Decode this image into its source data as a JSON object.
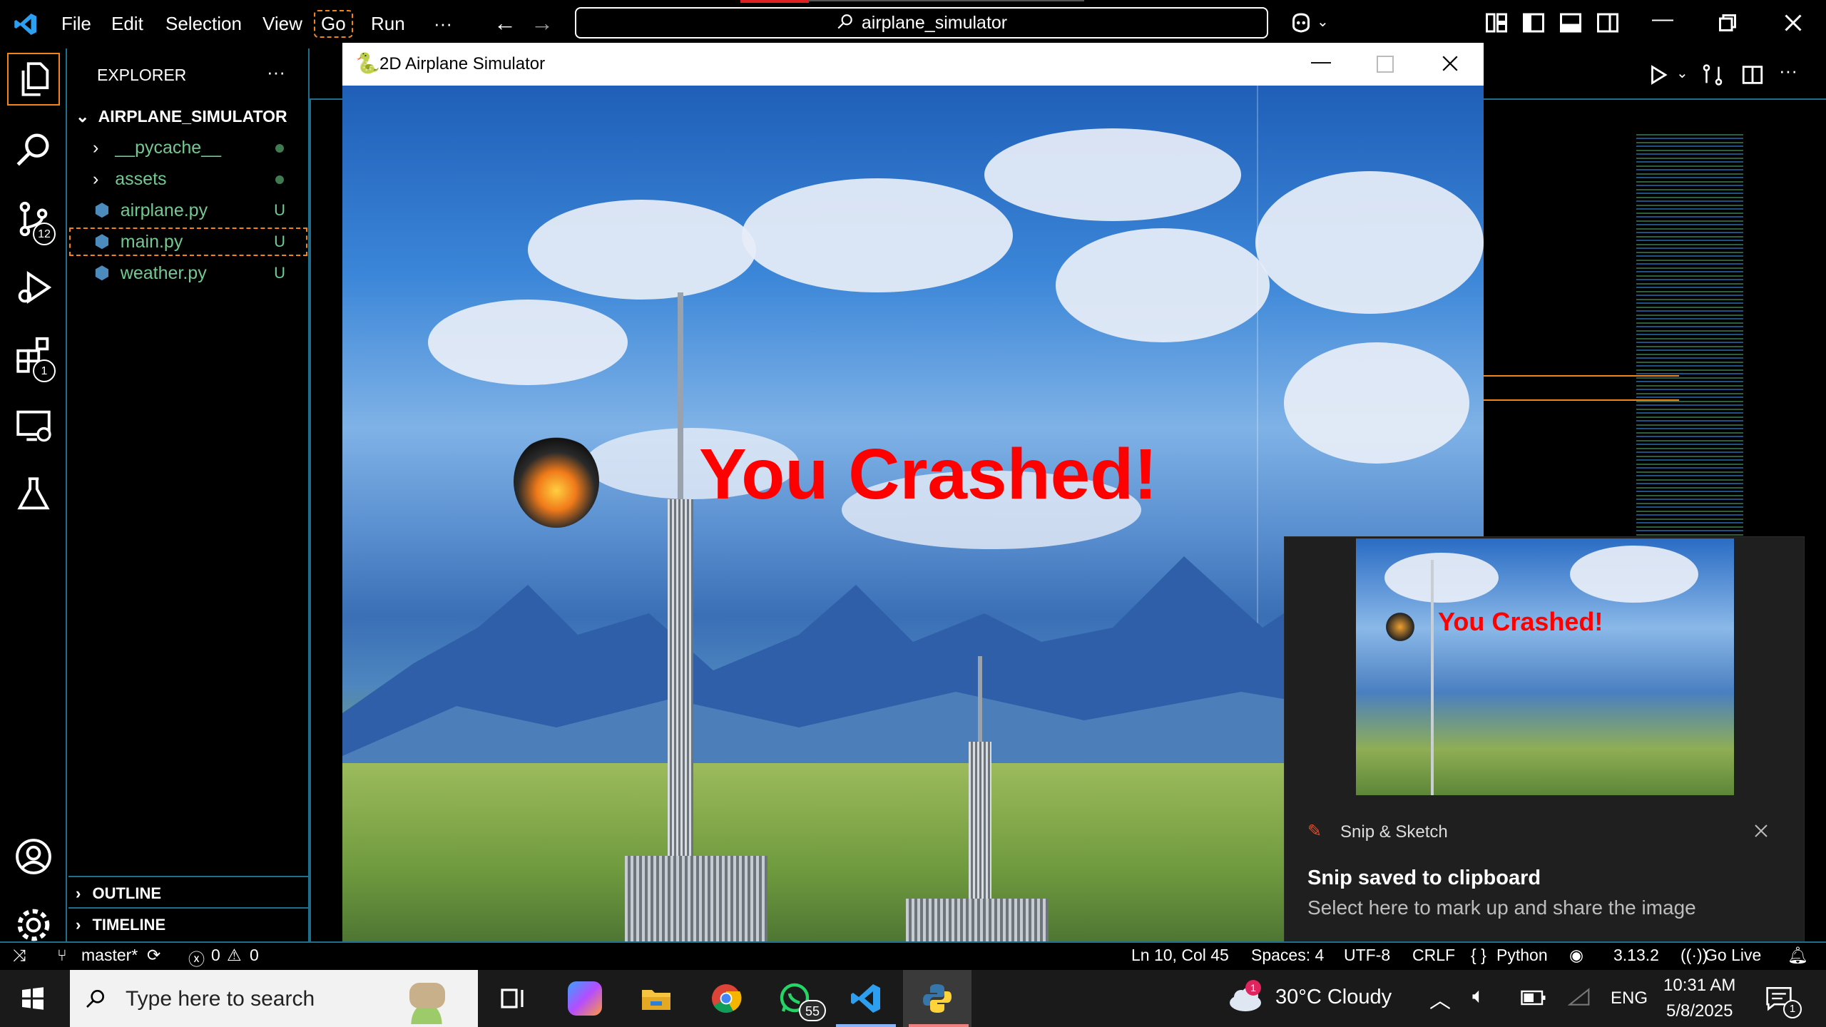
{
  "titlebar": {
    "menu": [
      "File",
      "Edit",
      "Selection",
      "View",
      "Go",
      "Run",
      "···"
    ],
    "search_text": "airplane_simulator"
  },
  "activitybar": {
    "scm_badge": "12",
    "extensions_badge": "1"
  },
  "explorer": {
    "header": "EXPLORER",
    "more": "···",
    "root": "AIRPLANE_SIMULATOR",
    "items": [
      {
        "label": "__pycache__",
        "type": "folder",
        "status": "dot"
      },
      {
        "label": "assets",
        "type": "folder",
        "status": "dot"
      },
      {
        "label": "airplane.py",
        "type": "file",
        "status": "U"
      },
      {
        "label": "main.py",
        "type": "file",
        "status": "U"
      },
      {
        "label": "weather.py",
        "type": "file",
        "status": "U"
      }
    ],
    "outline": "OUTLINE",
    "timeline": "TIMELINE"
  },
  "game_window": {
    "title": "2D Airplane Simulator",
    "message": "You Crashed!",
    "message_color": "#ff0000"
  },
  "toast": {
    "app": "Snip & Sketch",
    "title": "Snip saved to clipboard",
    "body": "Select here to mark up and share the image",
    "thumb_message": "You Crashed!"
  },
  "statusbar": {
    "branch": "master*",
    "errors": "0",
    "warnings": "0",
    "position": "Ln 10, Col 45",
    "spaces": "Spaces: 4",
    "encoding": "UTF-8",
    "eol": "CRLF",
    "language": "Python",
    "version": "3.13.2",
    "golive": "Go Live"
  },
  "taskbar": {
    "search_placeholder": "Type here to search",
    "whatsapp_badge": "55",
    "weather": "30°C  Cloudy",
    "weather_badge": "1",
    "language": "ENG",
    "time": "10:31 AM",
    "date": "5/8/2025",
    "notif_count": "1"
  }
}
